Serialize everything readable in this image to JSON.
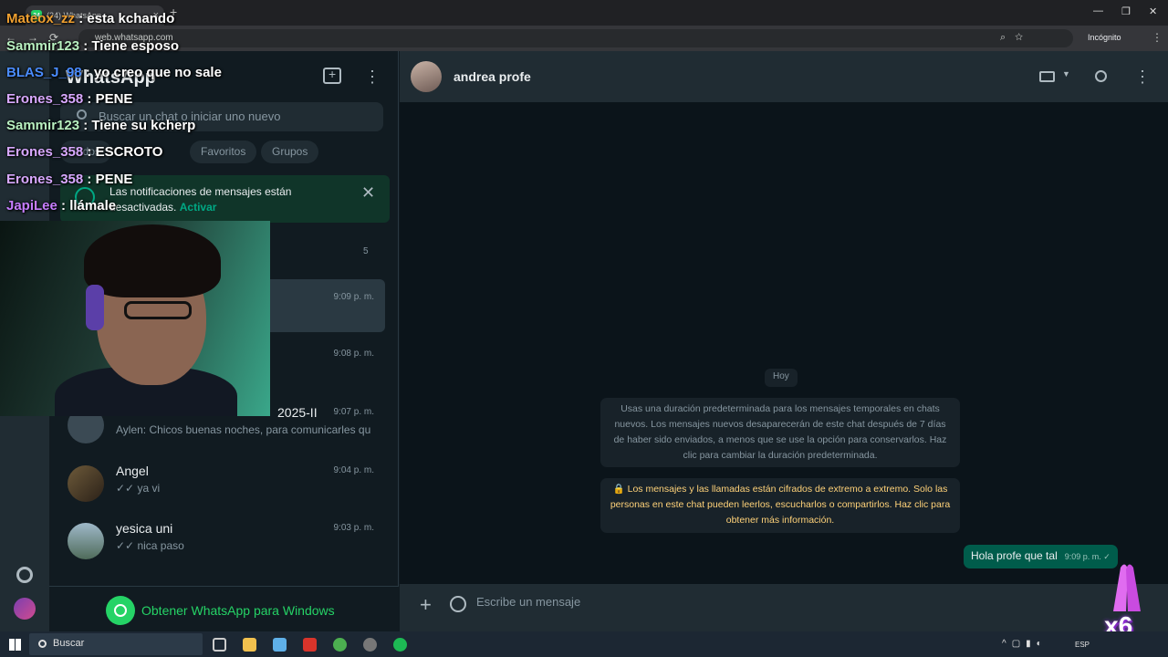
{
  "browser": {
    "tab_title": "(24) WhatsApp",
    "tab_badge": "24",
    "url": "web.whatsapp.com",
    "incognito_label": "Incógnito"
  },
  "sidebar": {
    "title": "WhatsApp",
    "search_placeholder": "Buscar un chat o iniciar uno nuevo",
    "filters": [
      "Todos",
      "Favoritos",
      "Grupos"
    ],
    "notification": {
      "text": "Las notificaciones de mensajes están desactivadas.",
      "action": "Activar"
    },
    "unread_count": "5",
    "chats": [
      {
        "name": "",
        "time": "9:09 p. m.",
        "preview": ""
      },
      {
        "name": "",
        "time": "9:08 p. m.",
        "preview": ""
      },
      {
        "name": "2025-II",
        "time": "9:07 p. m.",
        "preview": "Aylen: Chicos buenas noches, para comunicarles qu..."
      },
      {
        "name": "Angel",
        "time": "9:04 p. m.",
        "preview": "✓✓ ya vi"
      },
      {
        "name": "yesica uni",
        "time": "9:03 p. m.",
        "preview": "✓✓ nica paso"
      }
    ],
    "get_app_label": "Obtener WhatsApp para Windows"
  },
  "conversation": {
    "contact_name": "andrea profe",
    "day_label": "Hoy",
    "system_messages": [
      "Usas una duración predeterminada para los mensajes temporales en chats nuevos. Los mensajes nuevos desaparecerán de este chat después de 7 días de haber sido enviados, a menos que se use la opción para conservarlos. Haz clic para cambiar la duración predeterminada.",
      "🔒 Los mensajes y las llamadas están cifrados de extremo a extremo. Solo las personas en este chat pueden leerlos, escucharlos o compartirlos. Haz clic para obtener más información."
    ],
    "outgoing_message": {
      "text": "Hola profe que tal",
      "time": "9:09 p. m. ✓"
    },
    "input_placeholder": "Escribe un mensaje"
  },
  "stream_chat": [
    {
      "user": "Mateox_zz",
      "color": "#f0a030",
      "text": ": esta kchando"
    },
    {
      "user": "Sammir123",
      "color": "#b8f0c0",
      "text": ": Tiene esposo"
    },
    {
      "user": "BLAS_J_98",
      "color": "#4a8cff",
      "text": ": yo creo que no sale"
    },
    {
      "user": "Erones_358",
      "color": "#d8a8ff",
      "text": ": PENE"
    },
    {
      "user": "Sammir123",
      "color": "#b8f0c0",
      "text": ": Tiene su kcherp"
    },
    {
      "user": "Erones_358",
      "color": "#d8a8ff",
      "text": ": ESCROTO"
    },
    {
      "user": "Erones_358",
      "color": "#d8a8ff",
      "text": ": PENE"
    },
    {
      "user": "JapiLee",
      "color": "#c77dff",
      "text": ": llámale"
    }
  ],
  "overlay": {
    "multiplier": "x6"
  },
  "taskbar": {
    "search_label": "Buscar",
    "language": "ESP"
  },
  "colors": {
    "accent": "#00a884",
    "outgoing_bubble": "#005c4b",
    "panel": "#202c33",
    "background": "#0b141a"
  }
}
